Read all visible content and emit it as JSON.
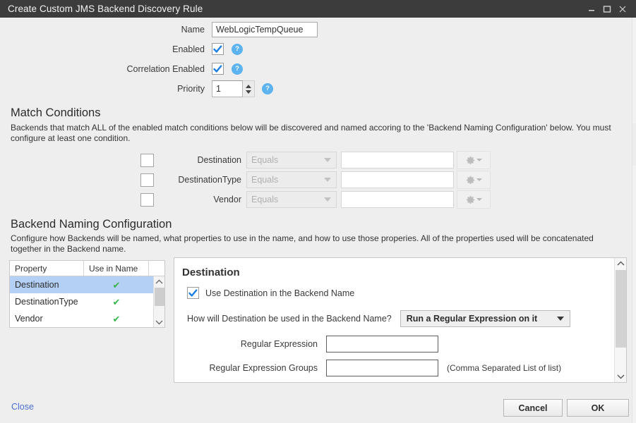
{
  "window": {
    "title": "Create Custom JMS Backend Discovery Rule",
    "controls": {
      "minimize": "minimize-icon",
      "maximize": "maximize-icon",
      "close": "close-icon"
    }
  },
  "form": {
    "name_label": "Name",
    "name_value": "WebLogicTempQueue",
    "enabled_label": "Enabled",
    "enabled_checked": true,
    "correlation_label": "Correlation Enabled",
    "correlation_checked": true,
    "priority_label": "Priority",
    "priority_value": "1",
    "help_glyph": "?"
  },
  "match_conditions": {
    "heading": "Match Conditions",
    "description": "Backends that match ALL of the enabled match conditions below will be discovered and named accoring to the 'Backend Naming Configuration' below.  You must configure at least one condition.",
    "rows": [
      {
        "label": "Destination",
        "operator": "Equals",
        "value": "",
        "checked": false
      },
      {
        "label": "DestinationType",
        "operator": "Equals",
        "value": "",
        "checked": false
      },
      {
        "label": "Vendor",
        "operator": "Equals",
        "value": "",
        "checked": false
      }
    ],
    "gear_icon": "gear-icon"
  },
  "naming_config": {
    "heading": "Backend Naming Configuration",
    "description": "Configure how Backends will be named, what properties to use in the name, and how to use those properies.  All of the properties used will be concatenated together in the Backend name.",
    "table": {
      "columns": [
        "Property",
        "Use in Name"
      ],
      "rows": [
        {
          "property": "Destination",
          "use_in_name": "✔",
          "selected": true
        },
        {
          "property": "DestinationType",
          "use_in_name": "✔",
          "selected": false
        },
        {
          "property": "Vendor",
          "use_in_name": "✔",
          "selected": false
        }
      ]
    },
    "detail": {
      "title": "Destination",
      "use_checkbox_label": "Use Destination in the Backend Name",
      "use_checkbox_checked": true,
      "how_label": "How will Destination be used in the Backend Name?",
      "how_value": "Run a Regular Expression on it",
      "regex_label": "Regular Expression",
      "regex_value": "",
      "regex_groups_label": "Regular Expression Groups",
      "regex_groups_value": "",
      "regex_groups_note": "(Comma Separated List of list)"
    }
  },
  "footer": {
    "close_link": "Close",
    "cancel_label": "Cancel",
    "ok_label": "OK"
  },
  "colors": {
    "titlebar": "#3c3c3c",
    "accent_help": "#5cb3ef",
    "check_blue": "#1a7ee5",
    "check_green": "#37b34a",
    "row_selected": "#b5d0f5",
    "link": "#4a6fd4"
  }
}
